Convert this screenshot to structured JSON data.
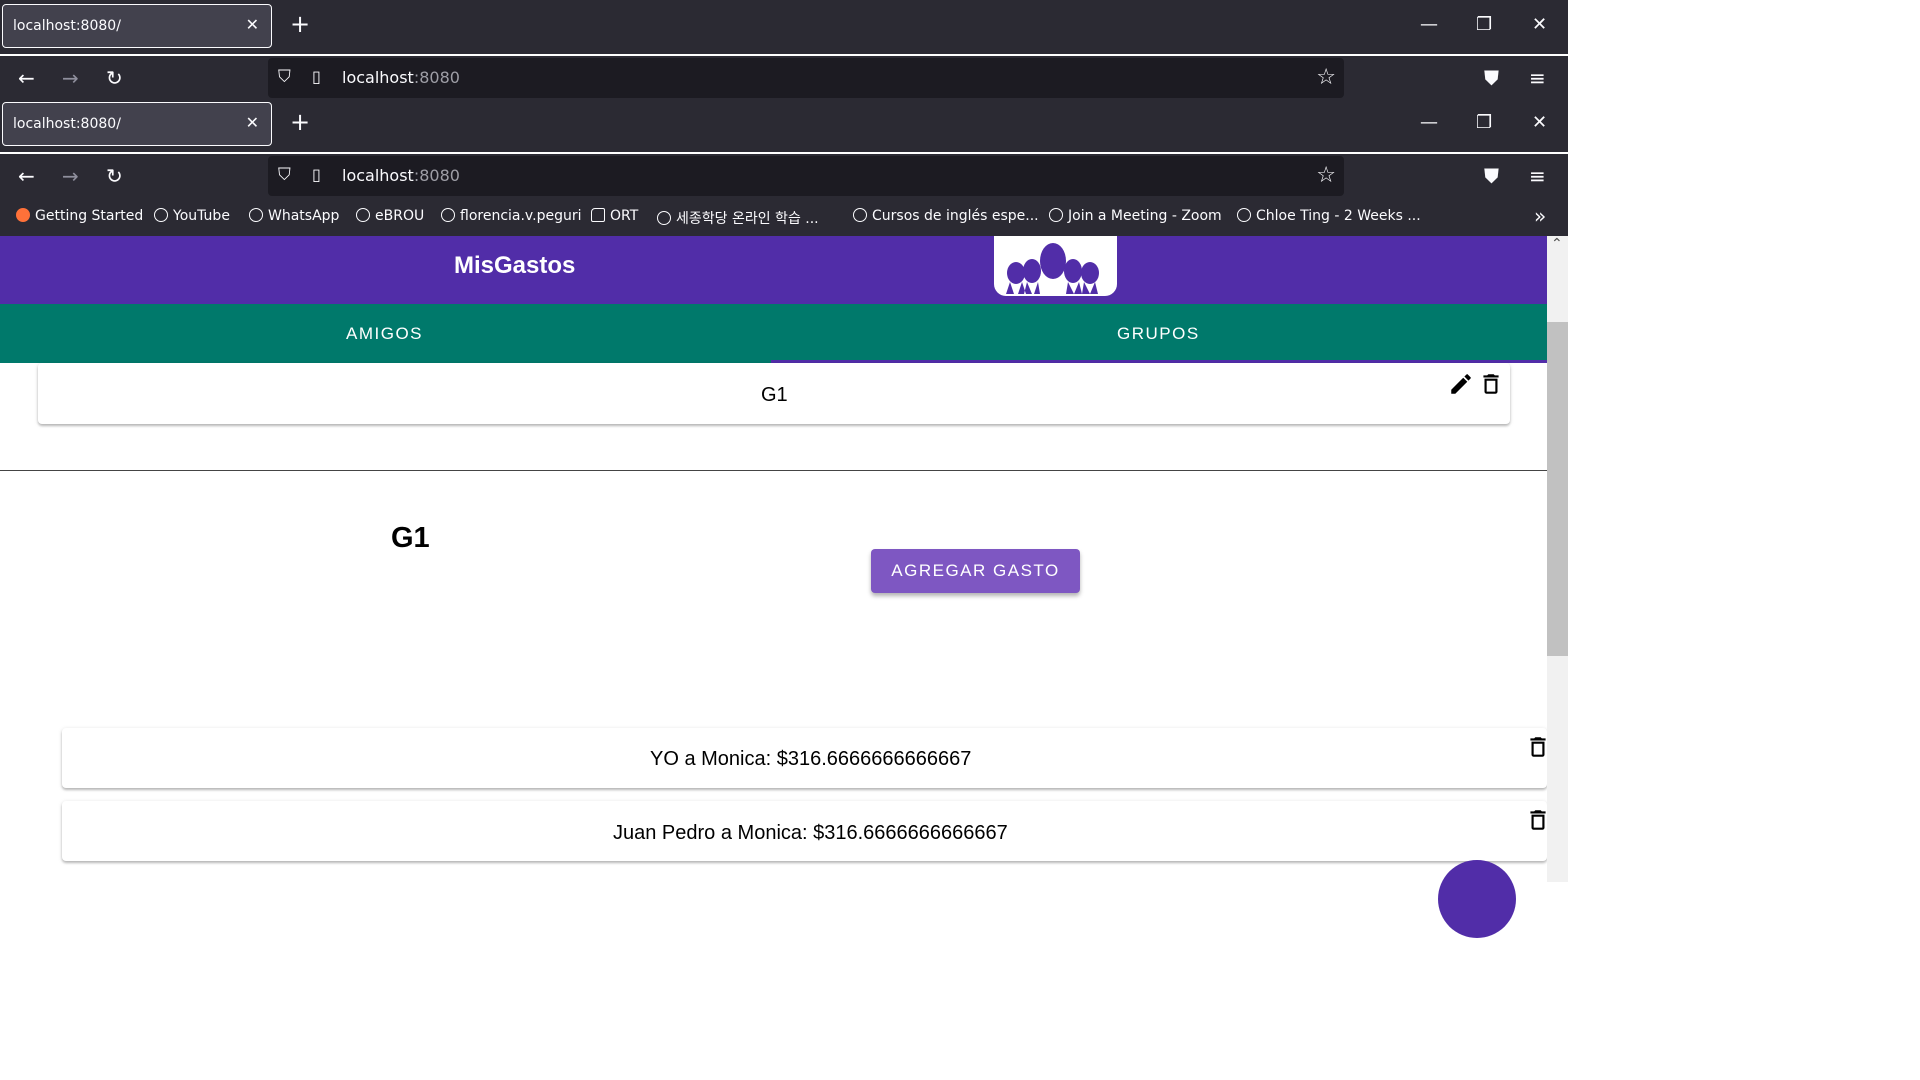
{
  "browser_windows": [
    {
      "tab_title": "localhost:8080/",
      "url_host": "localhost",
      "url_port": ":8080"
    },
    {
      "tab_title": "localhost:8080/",
      "url_host": "localhost",
      "url_port": ":8080"
    }
  ],
  "bookmarks": [
    {
      "label": "Getting Started",
      "icon": "firefox-icon"
    },
    {
      "label": "YouTube",
      "icon": "globe-icon"
    },
    {
      "label": "WhatsApp",
      "icon": "globe-icon"
    },
    {
      "label": "eBROU",
      "icon": "globe-icon"
    },
    {
      "label": "florencia.v.peguri",
      "icon": "globe-icon"
    },
    {
      "label": "ORT",
      "icon": "folder-icon"
    },
    {
      "label": "세종학당 온라인 학습 ...",
      "icon": "globe-icon"
    },
    {
      "label": "Cursos de inglés espe...",
      "icon": "globe-icon"
    },
    {
      "label": "Join a Meeting - Zoom",
      "icon": "globe-icon"
    },
    {
      "label": "Chloe Ting - 2 Weeks ...",
      "icon": "globe-icon"
    }
  ],
  "app": {
    "title": "MisGastos",
    "tabs": [
      "AMIGOS",
      "GRUPOS"
    ],
    "active_tab": "GRUPOS",
    "group_card": {
      "name": "G1"
    },
    "detail": {
      "title": "G1",
      "add_button": "AGREGAR GASTO",
      "debts": [
        "YO a Monica: $316.6666666666667",
        "Juan Pedro a Monica: $316.6666666666667"
      ]
    }
  },
  "colors": {
    "appbar": "#512da8",
    "tabs": "#00796b",
    "button": "#7e57c2",
    "chrome": "#2b2a33"
  }
}
